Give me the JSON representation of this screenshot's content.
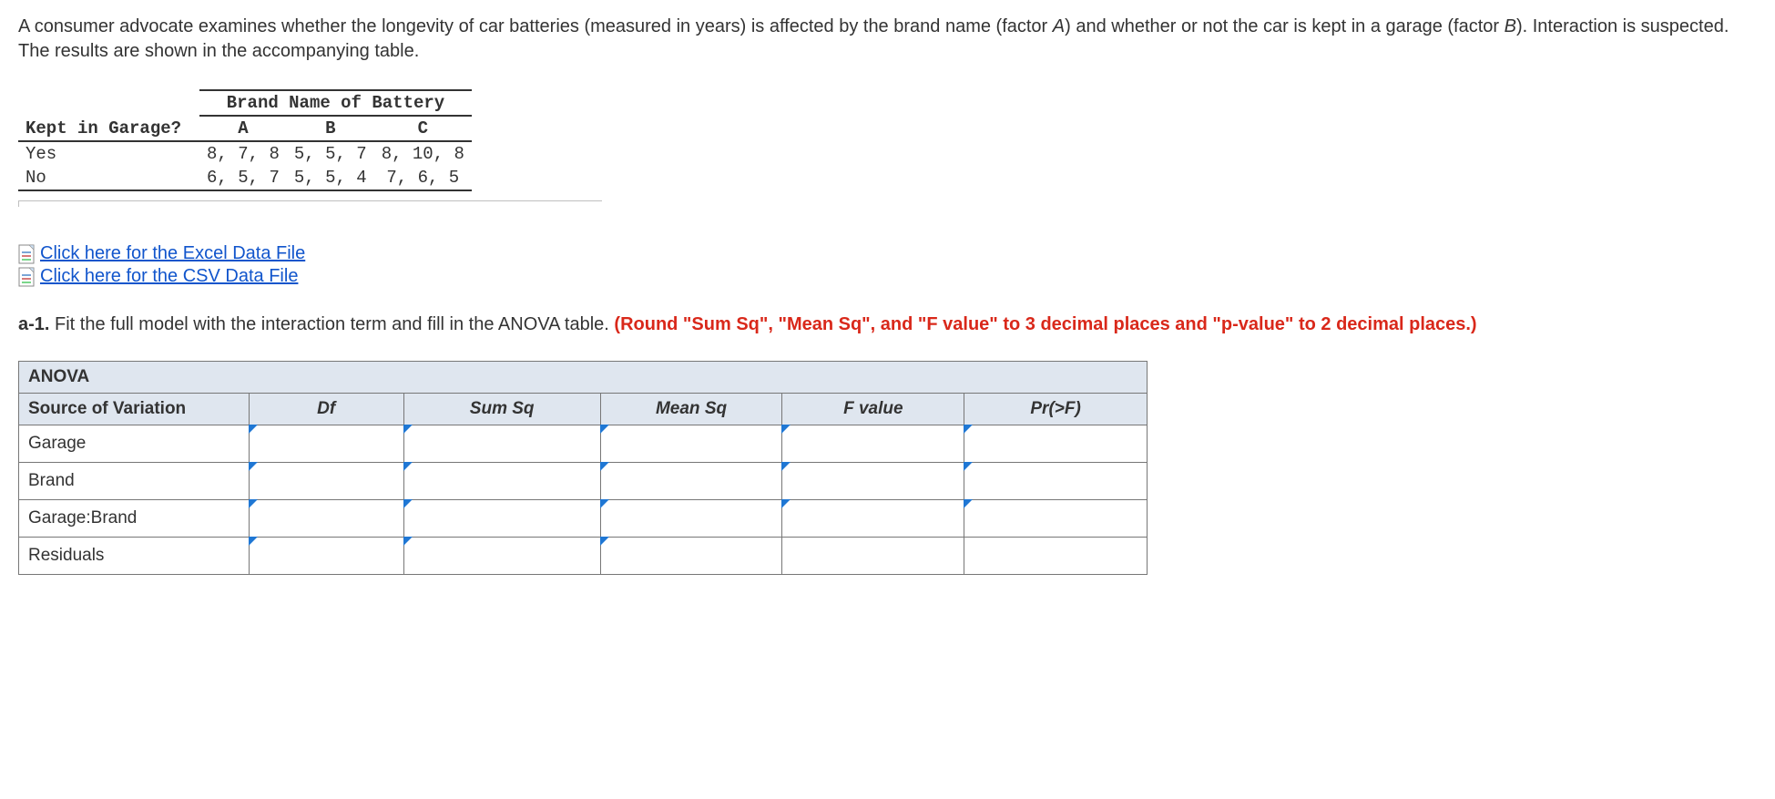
{
  "problem": {
    "line1_pre": "A consumer advocate examines whether the longevity of car batteries (measured in years) is affected by the brand name (factor ",
    "factorA": "A",
    "line1_mid": ") and whether or not the car is kept in a garage (factor ",
    "factorB": "B",
    "line1_post": "). Interaction is suspected. The results are shown in the accompanying table."
  },
  "data_table": {
    "brand_header": "Brand Name of Battery",
    "row_label_header": "Kept in Garage?",
    "cols": {
      "A": "A",
      "B": "B",
      "C": "C"
    },
    "rows": {
      "yes_label": "Yes",
      "yes": {
        "A": "8, 7, 8",
        "B": "5, 5, 7",
        "C": "8, 10, 8"
      },
      "no_label": "No",
      "no": {
        "A": "6, 5, 7",
        "B": "5, 5, 4",
        "C": "7, 6, 5"
      }
    }
  },
  "file_links": {
    "excel": "Click here for the Excel Data File",
    "csv": "Click here for the CSV Data File"
  },
  "question": {
    "prefix": "a-1.",
    "body": " Fit the full model with the interaction term and fill in the ANOVA table. ",
    "red": "(Round \"Sum Sq\", \"Mean Sq\", and \"F value\" to 3 decimal places and \"p-value\" to 2 decimal places.)"
  },
  "anova": {
    "title": "ANOVA",
    "headers": {
      "source": "Source of Variation",
      "df": "Df",
      "sumsq": "Sum Sq",
      "meansq": "Mean Sq",
      "fvalue": "F value",
      "prf": "Pr(>F)"
    },
    "rows": {
      "garage": "Garage",
      "brand": "Brand",
      "interaction": "Garage:Brand",
      "residuals": "Residuals"
    }
  },
  "chart_data": {
    "type": "table",
    "title": "Battery longevity (years) by Brand and Garage status",
    "factors": {
      "A": "Brand Name of Battery",
      "B": "Kept in Garage?"
    },
    "levels": {
      "brand": [
        "A",
        "B",
        "C"
      ],
      "garage": [
        "Yes",
        "No"
      ]
    },
    "observations": {
      "Yes": {
        "A": [
          8,
          7,
          8
        ],
        "B": [
          5,
          5,
          7
        ],
        "C": [
          8,
          10,
          8
        ]
      },
      "No": {
        "A": [
          6,
          5,
          7
        ],
        "B": [
          5,
          5,
          4
        ],
        "C": [
          7,
          6,
          5
        ]
      }
    },
    "anova_inputs": {
      "sources": [
        "Garage",
        "Brand",
        "Garage:Brand",
        "Residuals"
      ],
      "columns": [
        "Df",
        "Sum Sq",
        "Mean Sq",
        "F value",
        "Pr(>F)"
      ]
    }
  }
}
